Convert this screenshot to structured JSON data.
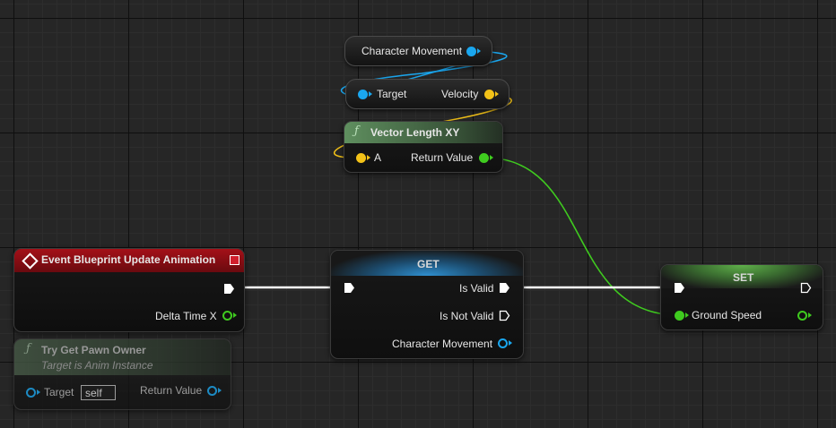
{
  "colors": {
    "object_pin": "#1aa7ef",
    "vector_pin": "#f3c218",
    "float_pin": "#3fcb1f",
    "exec_pin": "#ffffff",
    "event_header": "#8f1015",
    "function_header": "#4c7d4c",
    "get_header": "#2b87c2",
    "set_header": "#4a9e3a"
  },
  "character_movement_var": {
    "label": "Character Movement"
  },
  "get_velocity": {
    "target_label": "Target",
    "velocity_label": "Velocity"
  },
  "vector_length": {
    "icon": "function-icon",
    "title": "Vector Length XY",
    "input_label": "A",
    "output_label": "Return Value"
  },
  "event_node": {
    "icon": "event-icon",
    "title": "Event Blueprint Update Animation",
    "delta_label": "Delta Time X"
  },
  "try_get_pawn": {
    "icon": "function-icon",
    "title": "Try Get Pawn Owner",
    "subtitle": "Target is Anim Instance",
    "target_label": "Target",
    "target_value": "self",
    "return_label": "Return Value"
  },
  "get_node": {
    "title": "GET",
    "is_valid_label": "Is Valid",
    "is_not_valid_label": "Is Not Valid",
    "output_label": "Character Movement"
  },
  "set_node": {
    "title": "SET",
    "ground_speed_label": "Ground Speed"
  }
}
